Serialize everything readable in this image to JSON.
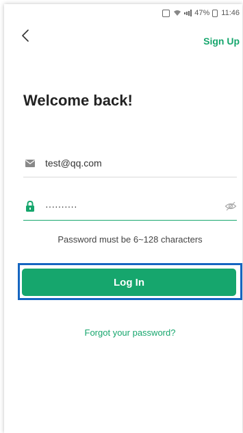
{
  "status_bar": {
    "battery": "47%",
    "time": "11:46"
  },
  "header": {
    "signup_label": "Sign Up"
  },
  "title": "Welcome back!",
  "email": {
    "value": "test@qq.com"
  },
  "password": {
    "value": "··········",
    "hint": "Password must be 6~128 characters"
  },
  "login_label": "Log In",
  "forgot_label": "Forgot your password?",
  "colors": {
    "accent": "#16a66d",
    "highlight": "#1565c0"
  }
}
